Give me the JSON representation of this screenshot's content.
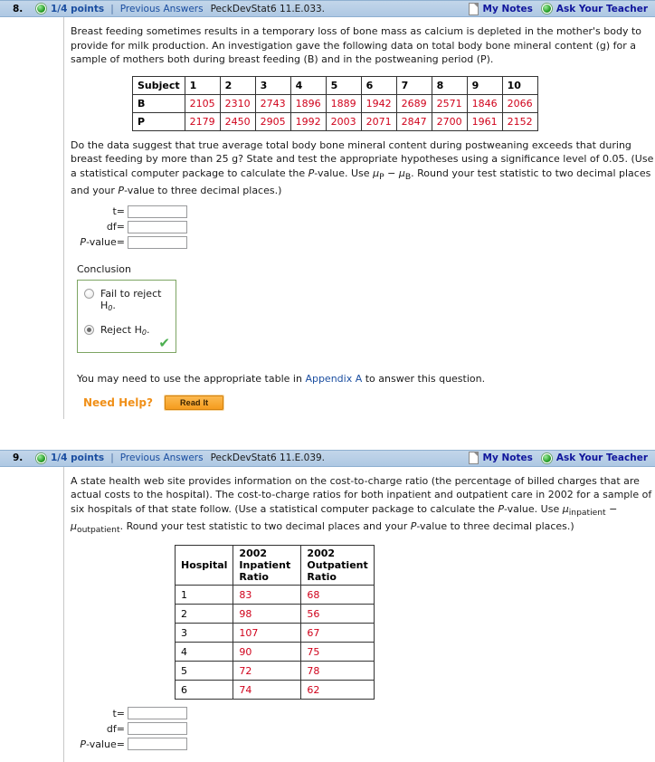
{
  "questions": [
    {
      "number": "8.",
      "points": "1/4 points",
      "separator": "|",
      "previous_answers": "Previous Answers",
      "code": "PeckDevStat6 11.E.033.",
      "my_notes": "My Notes",
      "ask_teacher": "Ask Your Teacher",
      "paragraphs": [
        "Breast feeding sometimes results in a temporary loss of bone mass as calcium is depleted in the mother's body to provide for milk production. An investigation gave the following data on total body bone mineral content (g) for a sample of mothers both during breast feeding (B) and in the postweaning period (P).",
        "Do the data suggest that true average total body bone mineral content during postweaning exceeds that during breast feeding by more than 25 g? State and test the appropriate hypotheses using a significance level of 0.05. (Use a statistical computer package to calculate the P-value. Use μP − μB. Round your test statistic to two decimal places and your P-value to three decimal places.)"
      ],
      "table": {
        "corner": "Subject",
        "columns": [
          "1",
          "2",
          "3",
          "4",
          "5",
          "6",
          "7",
          "8",
          "9",
          "10"
        ],
        "rows": [
          {
            "label": "B",
            "values": [
              "2105",
              "2310",
              "2743",
              "1896",
              "1889",
              "1942",
              "2689",
              "2571",
              "1846",
              "2066"
            ]
          },
          {
            "label": "P",
            "values": [
              "2179",
              "2450",
              "2905",
              "1992",
              "2003",
              "2071",
              "2847",
              "2700",
              "1961",
              "2152"
            ]
          }
        ]
      },
      "fields": [
        {
          "label": "t=",
          "value": "",
          "placeholder": ""
        },
        {
          "label": "df=",
          "value": "",
          "placeholder": ""
        },
        {
          "label": "P-value=",
          "value": "",
          "placeholder": ""
        }
      ],
      "conclusion": {
        "heading": "Conclusion",
        "options": [
          {
            "label": "Fail to reject H0.",
            "selected": false
          },
          {
            "label": "Reject H0.",
            "selected": true
          }
        ],
        "feedback_icon": "green-checkmark",
        "feedback_glyph": "✔"
      },
      "appendix_note": {
        "before": "You may need to use the appropriate table in ",
        "link": "Appendix A",
        "after": " to answer this question."
      },
      "need_help": {
        "label": "Need Help?",
        "button": "Read It"
      }
    },
    {
      "number": "9.",
      "points": "1/4 points",
      "separator": "|",
      "previous_answers": "Previous Answers",
      "code": "PeckDevStat6 11.E.039.",
      "my_notes": "My Notes",
      "ask_teacher": "Ask Your Teacher",
      "paragraphs": [
        "A state health web site provides information on the cost-to-charge ratio (the percentage of billed charges that are actual costs to the hospital). The cost-to-charge ratios for both inpatient and outpatient care in 2002 for a sample of six hospitals of that state follow. (Use a statistical computer package to calculate the P-value. Use μinpatient − μoutpatient. Round your test statistic to two decimal places and your P-value to three decimal places.)"
      ],
      "table": {
        "columns": [
          "Hospital",
          "2002 Inpatient Ratio",
          "2002 Outpatient Ratio"
        ],
        "rows": [
          [
            "1",
            "83",
            "68"
          ],
          [
            "2",
            "98",
            "56"
          ],
          [
            "3",
            "107",
            "67"
          ],
          [
            "4",
            "90",
            "75"
          ],
          [
            "5",
            "72",
            "78"
          ],
          [
            "6",
            "74",
            "62"
          ]
        ]
      },
      "fields": [
        {
          "label": "t=",
          "value": "",
          "placeholder": ""
        },
        {
          "label": "df=",
          "value": "",
          "placeholder": ""
        },
        {
          "label": "P-value=",
          "value": "",
          "placeholder": ""
        }
      ]
    }
  ],
  "colors": {
    "header_bar": "#b9cfe7",
    "link": "#1b4ea0",
    "data_value": "#d0021b",
    "need_help": "#f09019",
    "conclusion_border": "#7da563",
    "check": "#4caf50"
  }
}
